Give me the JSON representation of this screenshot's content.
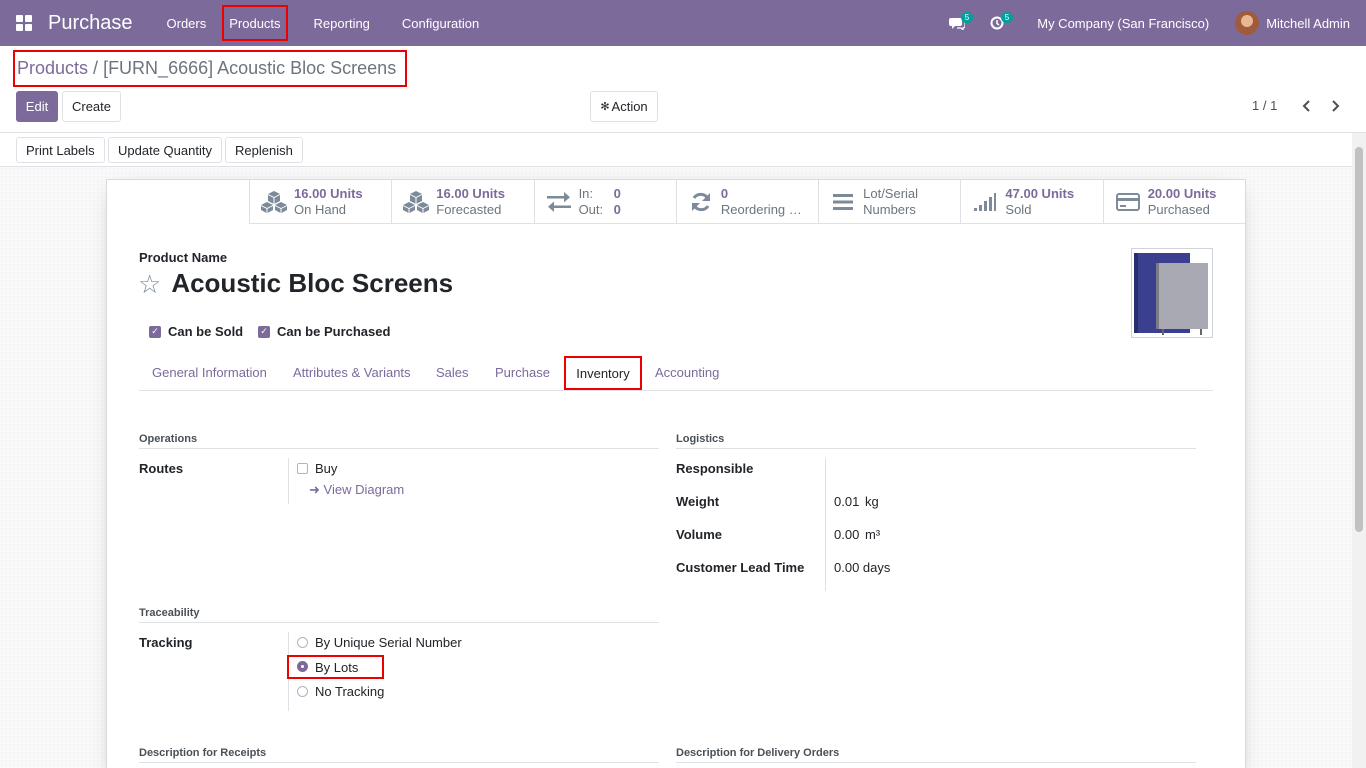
{
  "navbar": {
    "app_name": "Purchase",
    "menu": [
      "Orders",
      "Products",
      "Reporting",
      "Configuration"
    ],
    "messages_badge": "5",
    "activity_badge": "5",
    "company": "My Company (San Francisco)",
    "user": "Mitchell Admin",
    "accent_color": "#7c6a9b"
  },
  "breadcrumb": {
    "parent": "Products",
    "separator": "/",
    "current": "[FURN_6666] Acoustic Bloc Screens"
  },
  "controls": {
    "edit": "Edit",
    "create": "Create",
    "action": "Action",
    "pager": "1 / 1"
  },
  "statusbar": {
    "buttons": [
      "Print Labels",
      "Update Quantity",
      "Replenish"
    ]
  },
  "smart_buttons": {
    "on_hand": {
      "value": "16.00 Units",
      "label": "On Hand"
    },
    "forecasted": {
      "value": "16.00 Units",
      "label": "Forecasted"
    },
    "in_label": "In:",
    "in_value": "0",
    "out_label": "Out:",
    "out_value": "0",
    "reordering": {
      "value": "0",
      "label": "Reordering …"
    },
    "lots": {
      "line1": "Lot/Serial",
      "line2": "Numbers"
    },
    "sold": {
      "value": "47.00 Units",
      "label": "Sold"
    },
    "purchased": {
      "value": "20.00 Units",
      "label": "Purchased"
    }
  },
  "product": {
    "name_label": "Product Name",
    "name": "Acoustic Bloc Screens",
    "can_be_sold": "Can be Sold",
    "can_be_purchased": "Can be Purchased"
  },
  "tabs": [
    "General Information",
    "Attributes & Variants",
    "Sales",
    "Purchase",
    "Inventory",
    "Accounting"
  ],
  "inventory": {
    "operations_title": "Operations",
    "routes_label": "Routes",
    "route_buy": "Buy",
    "view_diagram": "View Diagram",
    "logistics_title": "Logistics",
    "responsible_label": "Responsible",
    "weight_label": "Weight",
    "weight_value": "0.01",
    "weight_unit": "kg",
    "volume_label": "Volume",
    "volume_value": "0.00",
    "volume_unit": "m³",
    "lead_time_label": "Customer Lead Time",
    "lead_time_value": "0.00 days",
    "traceability_title": "Traceability",
    "tracking_label": "Tracking",
    "tracking_options": [
      "By Unique Serial Number",
      "By Lots",
      "No Tracking"
    ],
    "tracking_selected": "By Lots",
    "desc_receipts": "Description for Receipts",
    "desc_delivery": "Description for Delivery Orders"
  }
}
